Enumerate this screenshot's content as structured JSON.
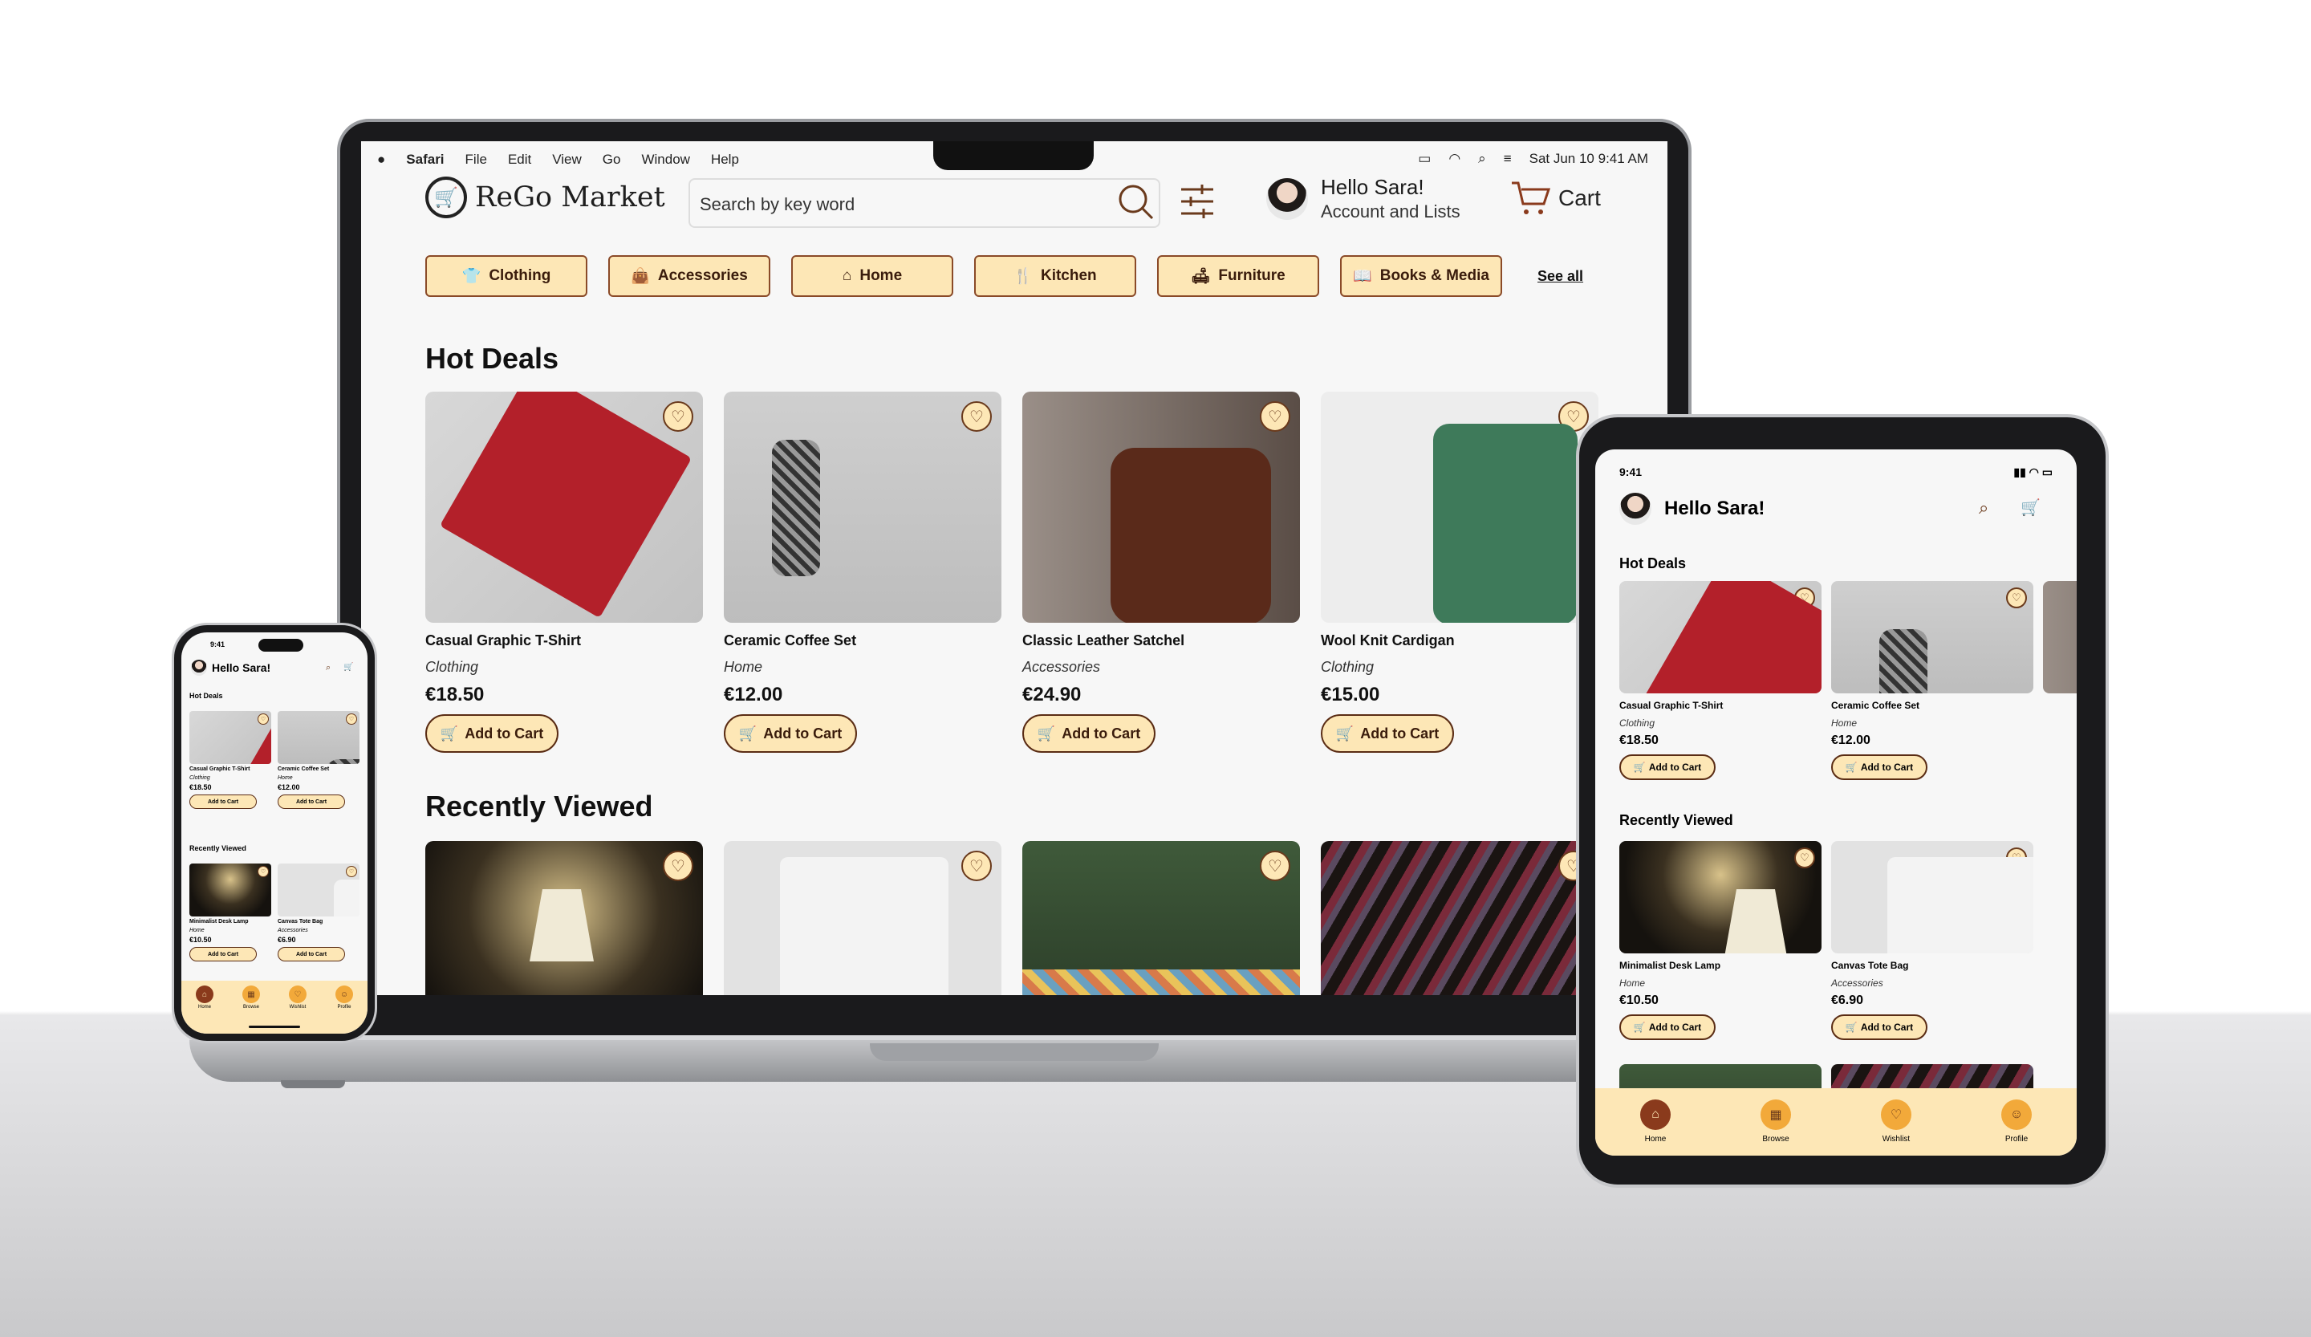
{
  "menubar": {
    "apple": "",
    "app": "Safari",
    "items": [
      "File",
      "Edit",
      "View",
      "Go",
      "Window",
      "Help"
    ],
    "datetime": "Sat Jun 10  9:41 AM"
  },
  "header": {
    "logo": "ReGo Market",
    "search_placeholder": "Search by key word",
    "greeting": "Hello Sara!",
    "account": "Account and Lists",
    "cart": "Cart"
  },
  "categories": [
    {
      "label": "Clothing",
      "icon": "shirt-icon"
    },
    {
      "label": "Accessories",
      "icon": "bag-icon"
    },
    {
      "label": "Home",
      "icon": "house-icon"
    },
    {
      "label": "Kitchen",
      "icon": "utensils-icon"
    },
    {
      "label": "Furniture",
      "icon": "sofa-icon"
    },
    {
      "label": "Books & Media",
      "icon": "book-icon"
    }
  ],
  "see_all": "See all",
  "hot_deals": {
    "title": "Hot Deals",
    "items": [
      {
        "name": "Casual Graphic T-Shirt",
        "category": "Clothing",
        "price": "€18.50"
      },
      {
        "name": "Ceramic Coffee Set",
        "category": "Home",
        "price": "€12.00"
      },
      {
        "name": "Classic Leather Satchel",
        "category": "Accessories",
        "price": "€24.90"
      },
      {
        "name": "Wool Knit Cardigan",
        "category": "Clothing",
        "price": "€15.00"
      }
    ]
  },
  "recently_viewed": {
    "title": "Recently Viewed",
    "items": [
      {
        "name": "Minimalist Desk Lamp",
        "category": "Home",
        "price": "€10.50"
      },
      {
        "name": "Canvas Tote Bag",
        "category": "Accessories",
        "price": "€6.90"
      }
    ]
  },
  "add_to_cart": "Add to Cart",
  "tablet": {
    "time": "9:41",
    "greeting": "Hello Sara!",
    "hot_deals": "Hot Deals",
    "recently_viewed": "Recently Viewed"
  },
  "phone": {
    "time": "9:41",
    "greeting": "Hello Sara!",
    "hot_deals": "Hot Deals",
    "recently_viewed": "Recently Viewed"
  },
  "nav": [
    "Home",
    "Browse",
    "Wishlist",
    "Profile"
  ],
  "colors": {
    "accent": "#fde7b6",
    "border": "#8a4a28",
    "nav_active": "#8a3a1c",
    "nav_icon": "#f2a93a"
  }
}
